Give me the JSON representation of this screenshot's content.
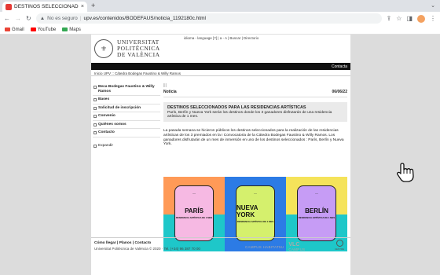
{
  "browser": {
    "tab_title": "DESTINOS SELECCIONADOS | C",
    "tab_close": "×",
    "new_tab": "+",
    "not_secure": "No es seguro",
    "url": "upv.es/contenidos/BODEFAUS/noticia_1192180c.html",
    "bookmarks": [
      {
        "label": "Gmail",
        "color": "#ea4335"
      },
      {
        "label": "YouTube",
        "color": "#ff0000"
      },
      {
        "label": "Maps",
        "color": "#34a853"
      }
    ]
  },
  "site": {
    "logo_lines": [
      "UNIVERSITAT",
      "POLITÈCNICA",
      "DE VALÈNCIA"
    ],
    "header_links": "idioma - language [?] | a - A | Buscar | Directorio",
    "contact_label": "Contacta",
    "breadcrumb": "Inicio UPV :: Cátedra Bodegas Faustino & Willy Ramos",
    "menu": [
      "Beca Bodegas Faustino & Willy Ramos",
      "Bases",
      "Solicitud de inscripción",
      "Convenio",
      "Quiénes somos",
      "Contacto"
    ],
    "expand_label": "Expandir",
    "content_top": "|||",
    "section": "Noticia",
    "date": "06/06/22",
    "news_title": "DESTINOS SELECCIONADOS PARA LAS RESIDENCIAS ARTÍSTICAS",
    "news_sub": "París, Berlín y Nueva York serán los destinos donde los 3 ganadores disfrutarán de una residencia artística de 1 mes.",
    "news_body": "La pasada semana se hicieron públicos los destinos seleccionados para la realización de las residencias artísticas de los 3 premiados en la I Convocatoria de la Cátedra Bodegas Faustino & Willy Ramos. Los ganadores disfrutarán de un mes de inmersión en uno de los destinos seleccionados : París, Berlín y Nueva York.",
    "banner": [
      {
        "city": "PARÍS",
        "sub": "RESIDENCIA ARTÍSTICA DE 1 MES",
        "top": "#ff9a57",
        "bottom": "#1ec7c9",
        "card": "#f6b9e3"
      },
      {
        "city": "NUEVA YORK",
        "sub": "RESIDENCIA ARTÍSTICA DE 1 MES",
        "top": "#2c7be5",
        "bottom": "#2c7be5",
        "card": "#d5f06d"
      },
      {
        "city": "BERLÍN",
        "sub": "RESIDENCIA ARTÍSTICA DE 1 MES",
        "top": "#f5e35a",
        "bottom": "#1ec7c9",
        "card": "#c69cf5"
      }
    ],
    "footer_line1": "Cómo llegar | Planos | Contacto",
    "footer_line2": "Universitat Politècnica de València © 2020 · Tel. (+34) 96 387 70 00",
    "footer_campus": "CAMPUS HABITAT5U",
    "footer_vlc": "VLC",
    "footer_vlc2": "CAMPUS",
    "footer_badge": "CENTRE"
  }
}
